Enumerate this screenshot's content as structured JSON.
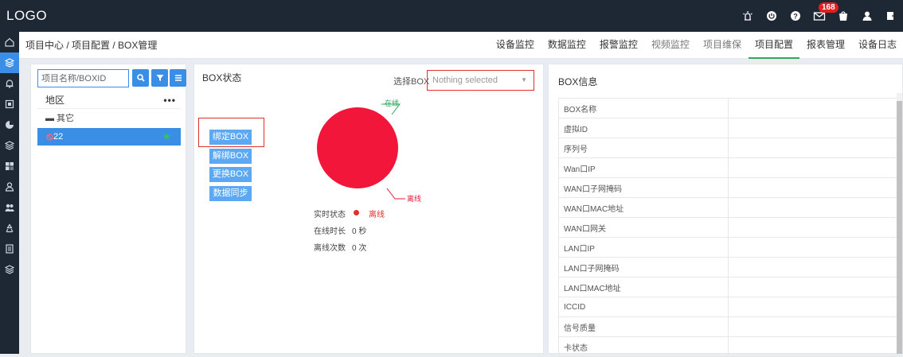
{
  "header": {
    "logo": "LOGO",
    "notifications_count": "168",
    "icons": [
      "alarm-light-icon",
      "power-icon",
      "help-icon",
      "mail-icon",
      "shopping-bag-icon",
      "user-icon",
      "logout-icon"
    ]
  },
  "sidebar": {
    "items": [
      "home-icon",
      "layers-icon",
      "bell-icon",
      "device-icon",
      "chart-icon",
      "layers-icon",
      "grid-icon",
      "person-icon",
      "users-icon",
      "recycle-icon",
      "document-icon",
      "layers-icon"
    ]
  },
  "breadcrumb": "项目中心 / 项目配置 / BOX管理",
  "nav_tabs": [
    {
      "label": "设备监控",
      "state": "normal"
    },
    {
      "label": "数据监控",
      "state": "normal"
    },
    {
      "label": "报警监控",
      "state": "normal"
    },
    {
      "label": "视频监控",
      "state": "gray"
    },
    {
      "label": "项目维保",
      "state": "gray"
    },
    {
      "label": "项目配置",
      "state": "active"
    },
    {
      "label": "报表管理",
      "state": "normal"
    },
    {
      "label": "设备日志",
      "state": "normal"
    }
  ],
  "left": {
    "search_placeholder": "项目名称/BOXID",
    "area_label": "地区",
    "more": "•••",
    "tree_parent": "▬ 其它",
    "tree_item": "22",
    "tree_item_icon": "offline-box-icon"
  },
  "mid": {
    "title": "BOX状态",
    "select_label": "选择BOX",
    "select_value": "Nothing selected",
    "buttons": {
      "bind": "绑定BOX",
      "unbind": "解绑BOX",
      "replace": "更换BOX",
      "sync": "数据同步"
    },
    "pie_labels": {
      "online": "在线",
      "offline": "离线"
    },
    "status": {
      "realtime_label": "实时状态",
      "realtime_value": "离线",
      "duration_label": "在线时长",
      "duration_value": "0 秒",
      "offline_count_label": "离线次数",
      "offline_count_value": "0 次"
    }
  },
  "right": {
    "title": "BOX信息",
    "fields": [
      "BOX名称",
      "虚拟ID",
      "序列号",
      "Wan口IP",
      "WAN口子网掩码",
      "WAN口MAC地址",
      "WAN口网关",
      "LAN口IP",
      "LAN口子网掩码",
      "LAN口MAC地址",
      "ICCID",
      "信号质量",
      "卡状态"
    ]
  },
  "chart_data": {
    "type": "pie",
    "categories": [
      "在线",
      "离线"
    ],
    "values": [
      0,
      100
    ],
    "colors": {
      "online": "#2aa75a",
      "offline": "#f2173a"
    }
  },
  "colors": {
    "accent": "#3a8ee6",
    "topbar": "#1e2734",
    "active_tab_underline": "#33a85c",
    "highlight_border": "#e0312a"
  }
}
